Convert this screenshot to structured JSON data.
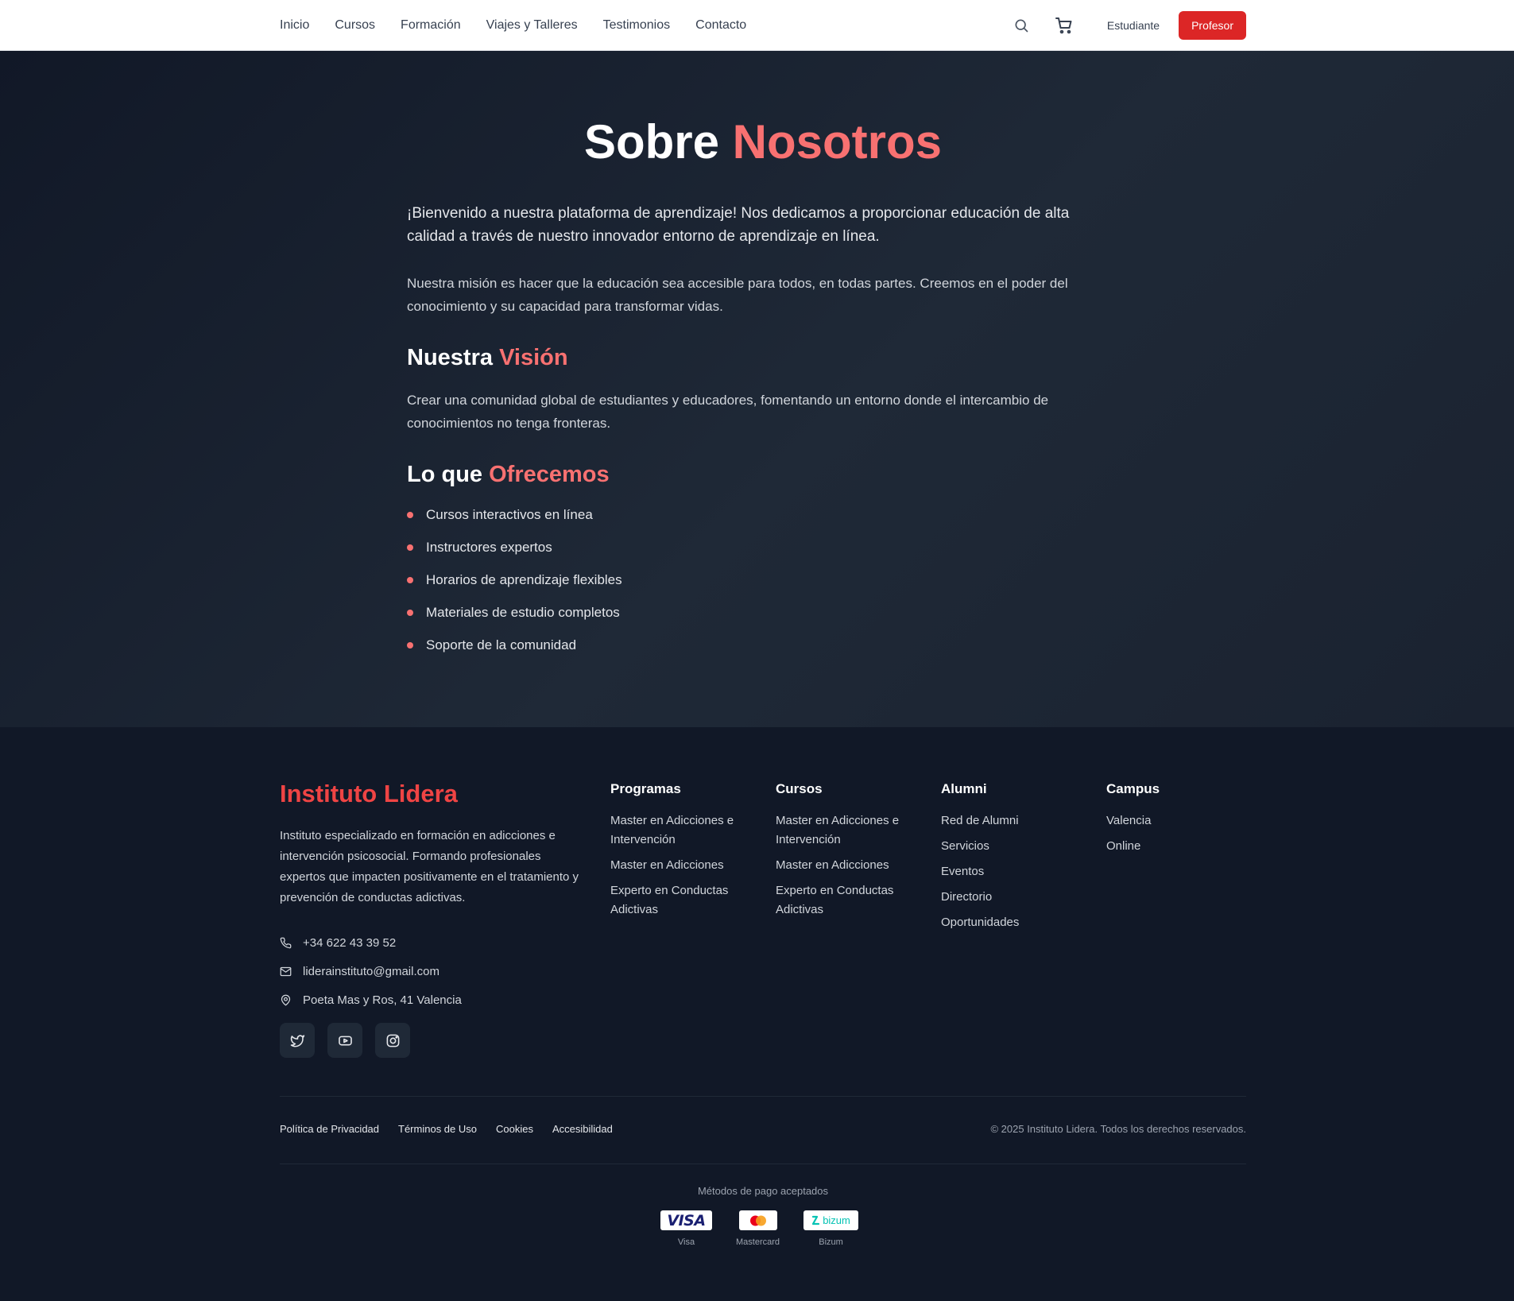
{
  "nav": {
    "items": [
      "Inicio",
      "Cursos",
      "Formación",
      "Viajes y Talleres",
      "Testimonios",
      "Contacto"
    ],
    "student_label": "Estudiante",
    "teacher_label": "Profesor"
  },
  "colors": {
    "accent": "#f87171",
    "brand": "#ef4444",
    "button": "#dc2626"
  },
  "hero": {
    "title_part1": "Sobre",
    "title_part2": "Nosotros",
    "intro": "¡Bienvenido a nuestra plataforma de aprendizaje! Nos dedicamos a proporcionar educación de alta calidad a través de nuestro innovador entorno de aprendizaje en línea.",
    "mission": "Nuestra misión es hacer que la educación sea accesible para todos, en todas partes. Creemos en el poder del conocimiento y su capacidad para transformar vidas.",
    "vision_title1": "Nuestra",
    "vision_title2": "Visión",
    "vision_text": "Crear una comunidad global de estudiantes y educadores, fomentando un entorno donde el intercambio de conocimientos no tenga fronteras.",
    "offer_title1": "Lo que",
    "offer_title2": "Ofrecemos",
    "offers": [
      "Cursos interactivos en línea",
      "Instructores expertos",
      "Horarios de aprendizaje flexibles",
      "Materiales de estudio completos",
      "Soporte de la comunidad"
    ]
  },
  "footer": {
    "brand": "Instituto Lidera",
    "description": "Instituto especializado en formación en adicciones e intervención psicosocial. Formando profesionales expertos que impacten positivamente en el tratamiento y prevención de conductas adictivas.",
    "phone": "+34 622 43 39 52",
    "email": "liderainstituto@gmail.com",
    "address": "Poeta Mas y Ros, 41 Valencia",
    "columns": [
      {
        "title": "Programas",
        "links": [
          "Master en Adicciones e Intervención",
          "Master en Adicciones",
          "Experto en Conductas Adictivas"
        ]
      },
      {
        "title": "Cursos",
        "links": [
          "Master en Adicciones e Intervención",
          "Master en Adicciones",
          "Experto en Conductas Adictivas"
        ]
      },
      {
        "title": "Alumni",
        "links": [
          "Red de Alumni",
          "Servicios",
          "Eventos",
          "Directorio",
          "Oportunidades"
        ]
      },
      {
        "title": "Campus",
        "links": [
          "Valencia",
          "Online"
        ]
      }
    ],
    "legal": [
      "Política de Privacidad",
      "Términos de Uso",
      "Cookies",
      "Accesibilidad"
    ],
    "copyright": "© 2025 Instituto Lidera. Todos los derechos reservados.",
    "payments_title": "Métodos de pago aceptados",
    "payments": [
      {
        "logo": "VISA",
        "label": "Visa"
      },
      {
        "logo": "mastercard-logo",
        "label": "Mastercard"
      },
      {
        "logo": "bizum",
        "label": "Bizum"
      }
    ]
  }
}
